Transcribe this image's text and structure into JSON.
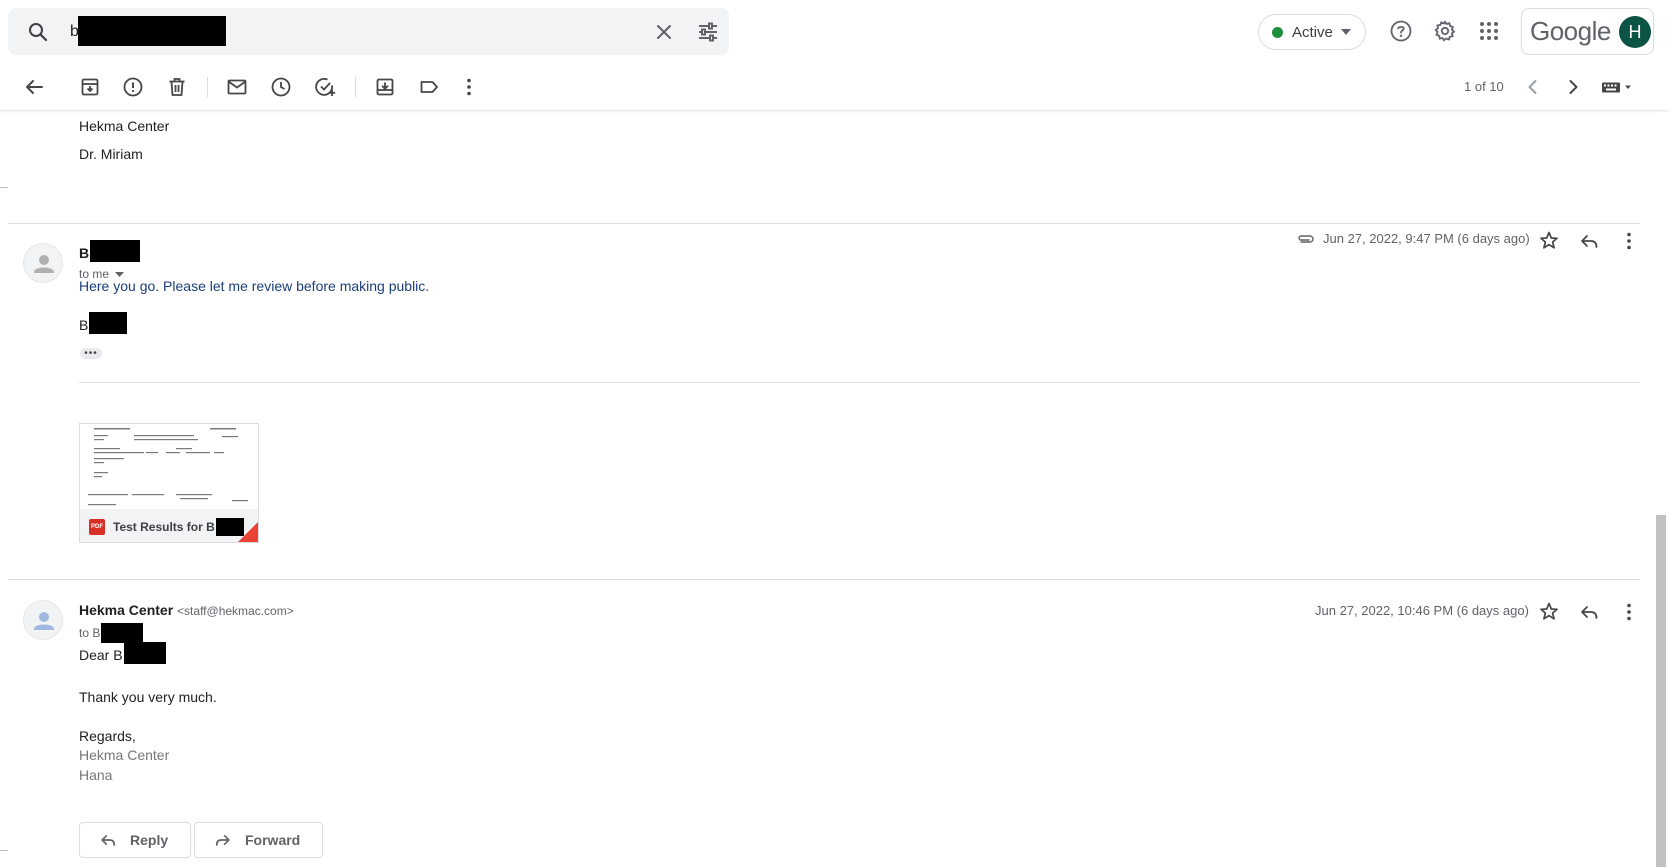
{
  "search": {
    "query": "b"
  },
  "header": {
    "status_label": "Active",
    "brand": "Google",
    "avatar_letter": "H"
  },
  "toolbar": {
    "pager": "1 of 10"
  },
  "messages": {
    "previous_tail": [
      "Hekma Center",
      "Dr. Miriam"
    ],
    "first": {
      "sender_initial": "B",
      "to": "to me",
      "timestamp": "Jun 27, 2022, 9:47 PM (6 days ago)",
      "body": "Here you go. Please let me review before making public.",
      "signature_initial": "B",
      "attachment": {
        "type_badge": "PDF",
        "name": "Test Results for B"
      }
    },
    "second": {
      "sender": "Hekma Center",
      "email": "<staff@hekmac.com>",
      "to": "to B",
      "timestamp": "Jun 27, 2022, 10:46 PM (6 days ago)",
      "greeting": "Dear B",
      "body": "Thank you very much.",
      "closing": "Regards,",
      "sig1": "Hekma Center",
      "sig2": "Hana"
    }
  },
  "actions": {
    "reply": "Reply",
    "forward": "Forward"
  },
  "colors": {
    "status_green": "#1e8e3e",
    "link_blue": "#1a3f7a",
    "avatar_bg": "#0b5345",
    "pdf_red": "#d93025"
  }
}
